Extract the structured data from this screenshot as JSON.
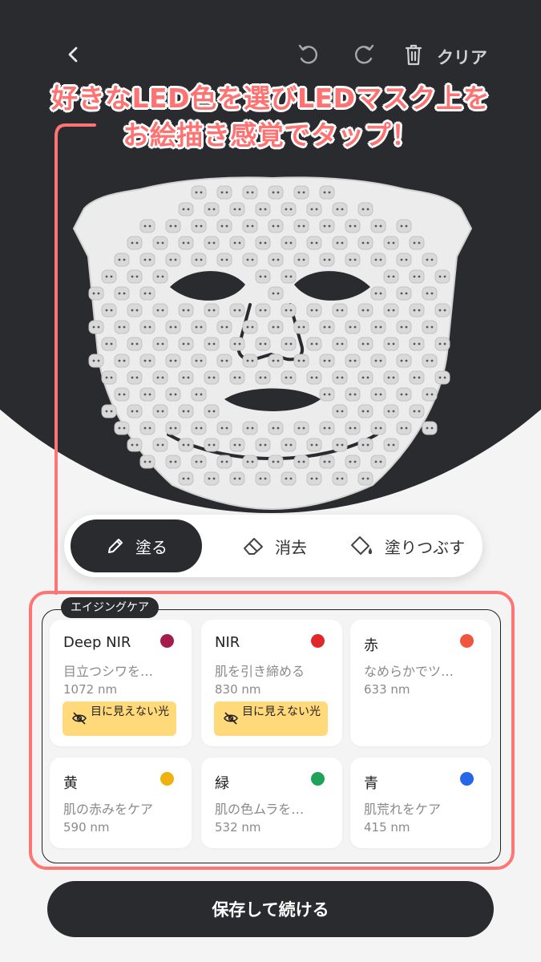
{
  "toolbar": {
    "back_icon": "chevron-left-icon",
    "undo_icon": "undo-icon",
    "redo_icon": "redo-icon",
    "trash_icon": "trash-icon",
    "clear_label": "クリア"
  },
  "headline": {
    "line1": "好きなLED色を選びLEDマスク上を",
    "line2": "お絵描き感覚でタップ！",
    "color": "#ff7272"
  },
  "modes": [
    {
      "label": "塗る",
      "icon": "pencil-icon",
      "active": true
    },
    {
      "label": "消去",
      "icon": "eraser-icon",
      "active": false
    },
    {
      "label": "塗りつぶす",
      "icon": "paint-bucket-icon",
      "active": false
    }
  ],
  "category": {
    "label": "エイジングケア"
  },
  "lights": [
    {
      "name": "Deep NIR",
      "desc": "目立つシワを…",
      "wavelength": "1072 nm",
      "color": "#a31c4a",
      "badge": "目に見えない光"
    },
    {
      "name": "NIR",
      "desc": "肌を引き締める",
      "wavelength": "830 nm",
      "color": "#e0282b",
      "badge": "目に見えない光"
    },
    {
      "name": "赤",
      "desc": "なめらかでツ…",
      "wavelength": "633 nm",
      "color": "#f0553f"
    },
    {
      "name": "黄",
      "desc": "肌の赤みをケア",
      "wavelength": "590 nm",
      "color": "#efb10f"
    },
    {
      "name": "緑",
      "desc": "肌の色ムラを…",
      "wavelength": "532 nm",
      "color": "#1fa35a"
    },
    {
      "name": "青",
      "desc": "肌荒れをケア",
      "wavelength": "415 nm",
      "color": "#2468e8"
    }
  ],
  "save_button": {
    "label": "保存して続ける"
  },
  "colors": {
    "dark": "#2a2b2e",
    "accent": "#ff7474",
    "badge": "#ffd97a"
  }
}
